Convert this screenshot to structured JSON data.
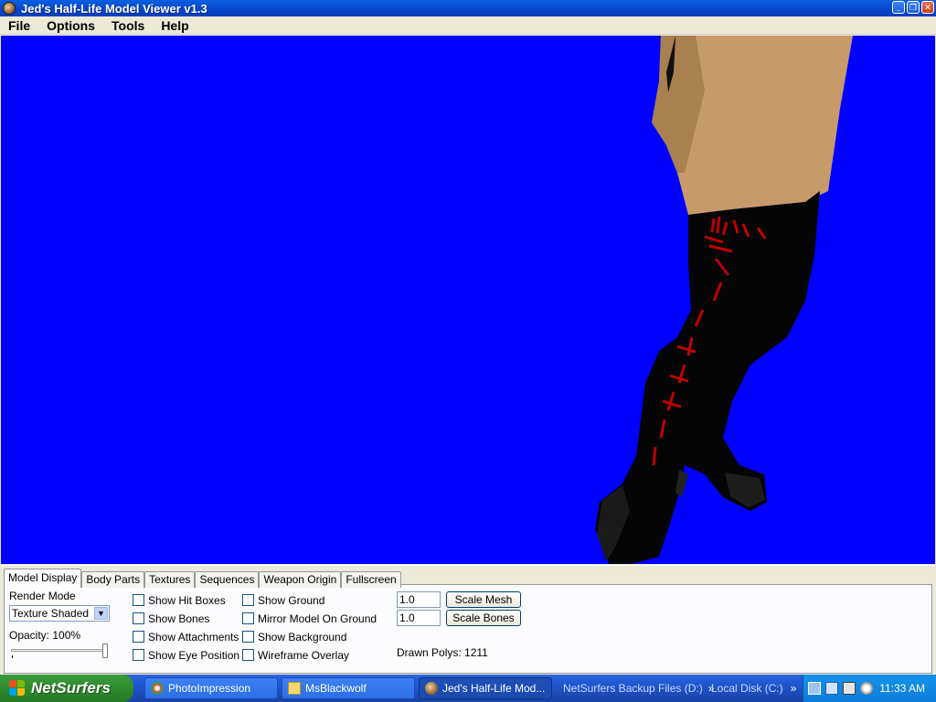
{
  "window": {
    "title": "Jed's Half-Life Model Viewer v1.3"
  },
  "menu": {
    "items": [
      "File",
      "Options",
      "Tools",
      "Help"
    ]
  },
  "viewport": {
    "background_color": "#0000ff"
  },
  "tabs": [
    "Model Display",
    "Body Parts",
    "Textures",
    "Sequences",
    "Weapon Origin",
    "Fullscreen"
  ],
  "active_tab": "Model Display",
  "model_display": {
    "render_mode_label": "Render Mode",
    "render_mode_value": "Texture Shaded",
    "opacity_label": "Opacity: 100%",
    "opacity_fraction": 1.0,
    "checkboxes_col1": [
      "Show Hit Boxes",
      "Show Bones",
      "Show Attachments",
      "Show Eye Position"
    ],
    "checkboxes_col2": [
      "Show Ground",
      "Mirror Model On Ground",
      "Show Background",
      "Wireframe Overlay"
    ],
    "scale_mesh_value": "1.0",
    "scale_bones_value": "1.0",
    "scale_mesh_button": "Scale Mesh",
    "scale_bones_button": "Scale Bones",
    "drawn_polys": "Drawn Polys: 1211"
  },
  "taskbar": {
    "start_label": "NetSurfers",
    "tasks": [
      "PhotoImpression",
      "MsBlackwolf",
      "Jed's Half-Life Mod..."
    ],
    "quick_links": [
      "NetSurfers Backup Files (D:)",
      "Local Disk (C:)"
    ],
    "clock": "11:33 AM"
  }
}
